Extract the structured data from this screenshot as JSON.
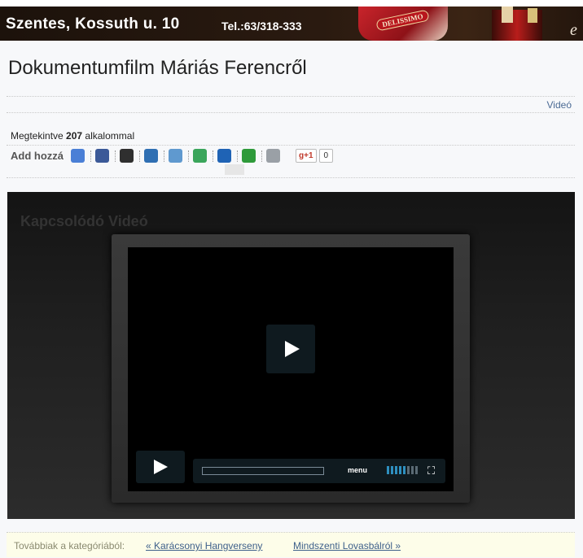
{
  "banner": {
    "address": "Szentes, Kossuth u. 10",
    "phone": "Tel.:63/318-333",
    "brand_text": "DELISSIMO",
    "tail_glyph": "e"
  },
  "article": {
    "title": "Dokumentumfilm Máriás Ferencről",
    "category_link": "Videó",
    "views_prefix": "Megtekintve",
    "views_count": "207",
    "views_suffix": "alkalommal",
    "share_label": "Add hozzá",
    "gplus_label": "g+1",
    "gplus_count": "0"
  },
  "share_icons": [
    {
      "name": "google-bookmarks-icon",
      "color": "#4a7fd6"
    },
    {
      "name": "facebook-icon",
      "color": "#3b5998"
    },
    {
      "name": "delicious-icon",
      "color": "#2f2f2f"
    },
    {
      "name": "myspace-icon",
      "color": "#2f6fb3"
    },
    {
      "name": "reddit-icon",
      "color": "#5f99cf"
    },
    {
      "name": "stumbleupon-icon",
      "color": "#3aa55b"
    },
    {
      "name": "iwiw-icon",
      "color": "#1f63b5"
    },
    {
      "name": "chat-icon",
      "color": "#2e9a3a"
    },
    {
      "name": "link-icon",
      "color": "#9aa0a6"
    }
  ],
  "player": {
    "related_title": "Kapcsolódó Videó",
    "menu_label": "menu",
    "volume_level": 0.6
  },
  "footer_nav": {
    "label": "Továbbiak a kategóriából:",
    "prev": "« Karácsonyi Hangverseny",
    "next": "Mindszenti Lovasbálról »"
  }
}
